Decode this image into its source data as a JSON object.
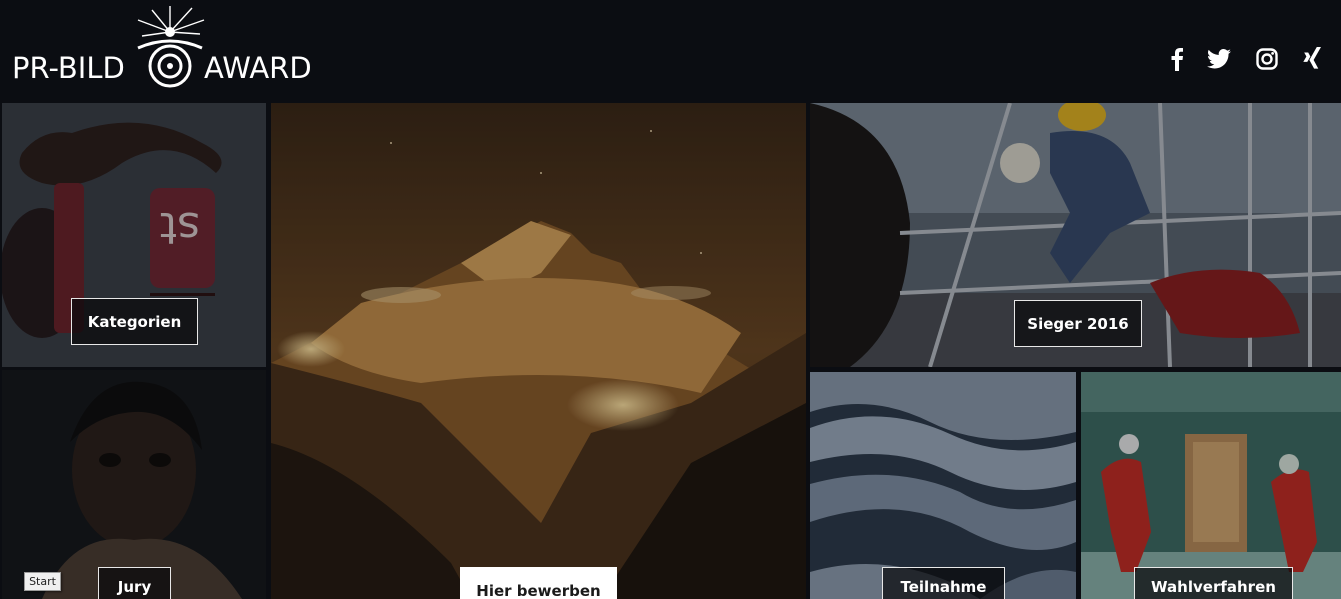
{
  "header": {
    "logo": {
      "left_text": "PR-BILD",
      "right_text": "AWARD"
    },
    "social": [
      {
        "name": "facebook-icon",
        "glyph": "facebook"
      },
      {
        "name": "twitter-icon",
        "glyph": "twitter"
      },
      {
        "name": "instagram-icon",
        "glyph": "instagram"
      },
      {
        "name": "xing-icon",
        "glyph": "xing"
      }
    ]
  },
  "tiles": {
    "kategorien": {
      "label": "Kategorien"
    },
    "jury": {
      "label": "Jury"
    },
    "hier_bewerben": {
      "label": "Hier bewerben"
    },
    "sieger_2016": {
      "label": "Sieger 2016"
    },
    "teilnahme": {
      "label": "Teilnahme"
    },
    "wahlverfahren": {
      "label": "Wahlverfahren"
    }
  },
  "start_badge": "Start",
  "colors": {
    "background": "#0b0d12",
    "text": "#ffffff",
    "mountain_glow": "#e0a24a",
    "button_border": "#e8e8e8"
  }
}
